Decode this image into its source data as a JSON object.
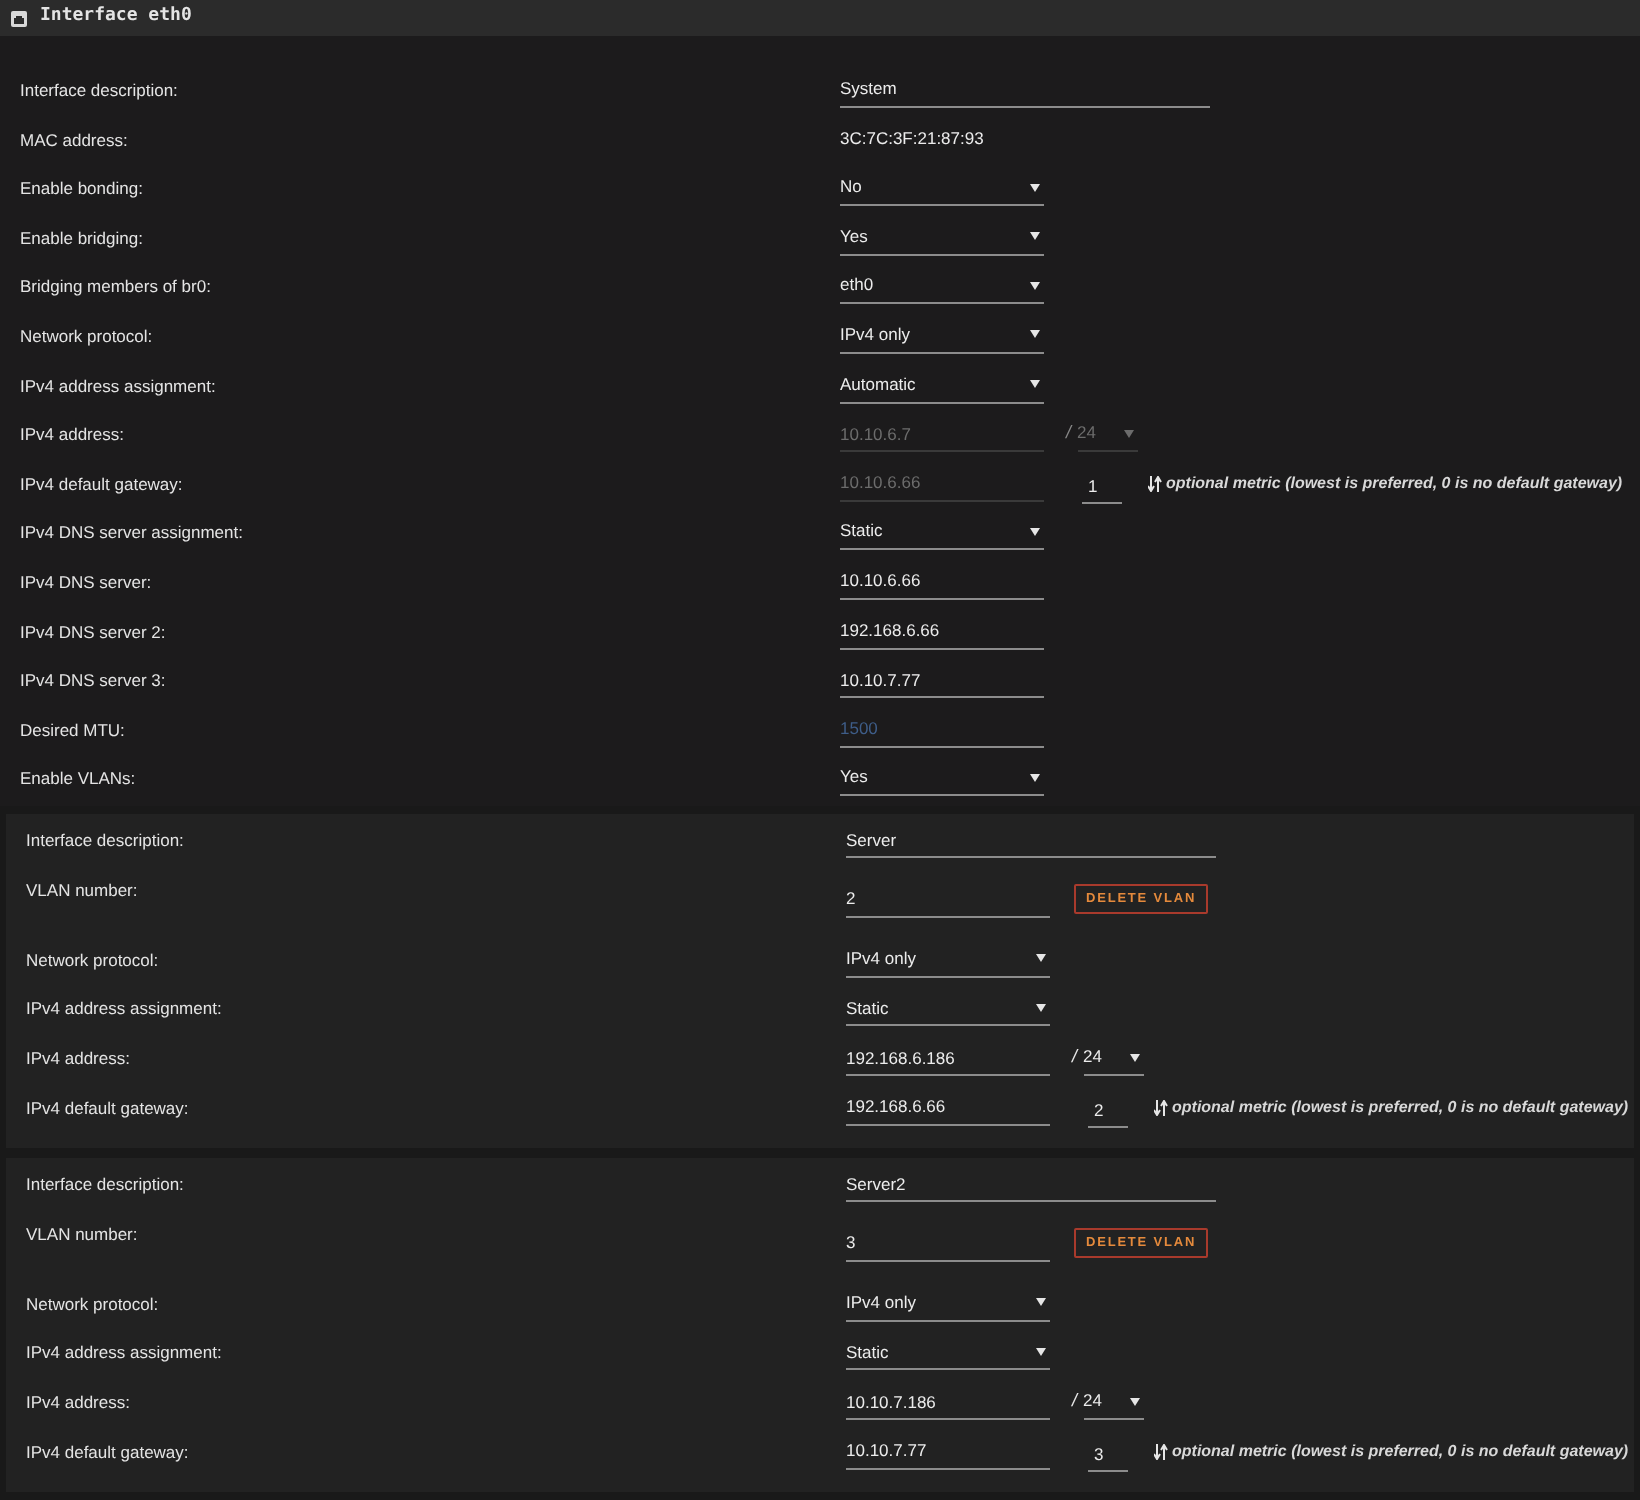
{
  "panel": {
    "title": "Interface eth0"
  },
  "main_rows": [
    {
      "kind": "description",
      "label": "Interface description:",
      "value": "System",
      "disabled": false
    },
    {
      "kind": "static",
      "label": "MAC address:",
      "value": "3C:7C:3F:21:87:93",
      "disabled": false
    },
    {
      "kind": "select",
      "label": "Enable bonding:",
      "value": "No",
      "disabled": false
    },
    {
      "kind": "select",
      "label": "Enable bridging:",
      "value": "Yes",
      "disabled": false
    },
    {
      "kind": "select",
      "label": "Bridging members of br0:",
      "value": "eth0",
      "disabled": false
    },
    {
      "kind": "select",
      "label": "Network protocol:",
      "value": "IPv4 only",
      "disabled": false
    },
    {
      "kind": "select",
      "label": "IPv4 address assignment:",
      "value": "Automatic",
      "disabled": false
    },
    {
      "kind": "address",
      "label": "IPv4 address:",
      "value": "10.10.6.7",
      "disabled": true,
      "separator": "/",
      "prefix": {
        "value": "24",
        "disabled": true
      }
    },
    {
      "kind": "gateway",
      "label": "IPv4 default gateway:",
      "value": "10.10.6.66",
      "disabled": true,
      "metric": {
        "value": "1",
        "disabled": false
      },
      "hint": "optional metric (lowest is preferred, 0 is no default gateway)"
    },
    {
      "kind": "select",
      "label": "IPv4 DNS server assignment:",
      "value": "Static",
      "disabled": false
    },
    {
      "kind": "text",
      "label": "IPv4 DNS server:",
      "value": "10.10.6.66",
      "disabled": false
    },
    {
      "kind": "text",
      "label": "IPv4 DNS server 2:",
      "value": "192.168.6.66",
      "disabled": false
    },
    {
      "kind": "text",
      "label": "IPv4 DNS server 3:",
      "value": "10.10.7.77",
      "disabled": false
    },
    {
      "kind": "text",
      "label": "Desired MTU:",
      "placeholder": "1500",
      "disabled": false
    },
    {
      "kind": "select",
      "label": "Enable VLANs:",
      "value": "Yes",
      "disabled": false
    }
  ],
  "vlans": [
    {
      "rows": [
        {
          "kind": "description",
          "label": "Interface description:",
          "value": "Server",
          "disabled": false
        },
        {
          "kind": "vlan_number",
          "label": "VLAN number:",
          "value": "2",
          "disabled": false,
          "button": "DELETE VLAN"
        },
        {
          "kind": "select",
          "label": "Network protocol:",
          "value": "IPv4 only",
          "disabled": false
        },
        {
          "kind": "select",
          "label": "IPv4 address assignment:",
          "value": "Static",
          "disabled": false
        },
        {
          "kind": "address",
          "label": "IPv4 address:",
          "value": "192.168.6.186",
          "disabled": false,
          "separator": "/",
          "prefix": {
            "value": "24",
            "disabled": false
          }
        },
        {
          "kind": "gateway",
          "label": "IPv4 default gateway:",
          "value": "192.168.6.66",
          "disabled": false,
          "metric": {
            "value": "2",
            "disabled": false
          },
          "hint": "optional metric (lowest is preferred, 0 is no default gateway)"
        }
      ]
    },
    {
      "rows": [
        {
          "kind": "description",
          "label": "Interface description:",
          "value": "Server2",
          "disabled": false
        },
        {
          "kind": "vlan_number",
          "label": "VLAN number:",
          "value": "3",
          "disabled": false,
          "button": "DELETE VLAN"
        },
        {
          "kind": "select",
          "label": "Network protocol:",
          "value": "IPv4 only",
          "disabled": false
        },
        {
          "kind": "select",
          "label": "IPv4 address assignment:",
          "value": "Static",
          "disabled": false
        },
        {
          "kind": "address",
          "label": "IPv4 address:",
          "value": "10.10.7.186",
          "disabled": false,
          "separator": "/",
          "prefix": {
            "value": "24",
            "disabled": false
          }
        },
        {
          "kind": "gateway",
          "label": "IPv4 default gateway:",
          "value": "10.10.7.77",
          "disabled": false,
          "metric": {
            "value": "3",
            "disabled": false
          },
          "hint": "optional metric (lowest is preferred, 0 is no default gateway)"
        }
      ]
    }
  ]
}
